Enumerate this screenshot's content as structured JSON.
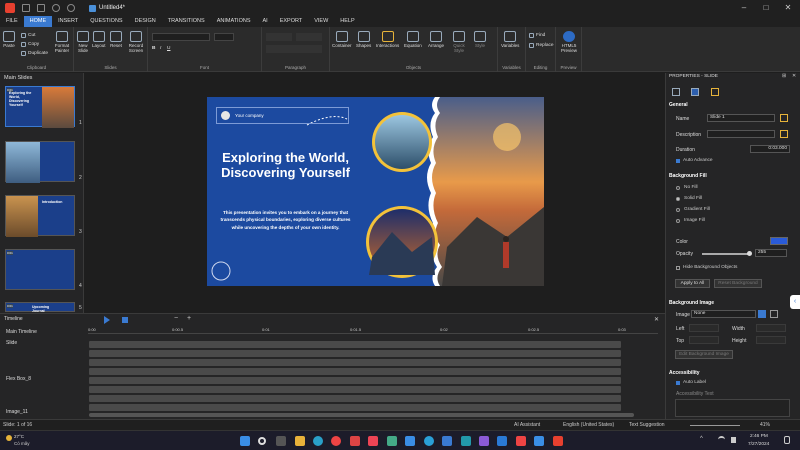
{
  "titlebar": {
    "doc_title": "Untitled4*"
  },
  "menu": [
    "FILE",
    "HOME",
    "INSERT",
    "QUESTIONS",
    "DESIGN",
    "TRANSITIONS",
    "ANIMATIONS",
    "AI",
    "EXPORT",
    "VIEW",
    "HELP"
  ],
  "ribbon": {
    "clipboard": {
      "paste": "Paste",
      "cut": "Cut",
      "copy": "Copy",
      "duplicate": "Duplicate",
      "format_painter": "Format Painter",
      "label": "Clipboard"
    },
    "slides": {
      "new_slide": "New Slide",
      "layout": "Layout",
      "reset": "Reset",
      "record": "Record Screen",
      "label": "Slides"
    },
    "font": {
      "label": "Font"
    },
    "paragraph": {
      "label": "Paragraph"
    },
    "objects": {
      "container": "Container",
      "shapes": "Shapes",
      "interactions": "Interactions",
      "equation": "Equation",
      "arrange": "Arrange",
      "quick_style": "Quick Style",
      "style": "Style",
      "label": "Objects"
    },
    "variables": {
      "btn": "Variables",
      "label": "Variables"
    },
    "editing": {
      "find": "Find",
      "replace": "Replace",
      "label": "Editing"
    },
    "preview": {
      "btn": "HTML5 Preview",
      "label": "Preview"
    }
  },
  "slides_panel": {
    "title": "Main Slides",
    "thumbs": [
      {
        "num": "1",
        "title": "Exploring the World, Discovering Yourself",
        "badge": "0:01"
      },
      {
        "num": "2",
        "title": "",
        "badge": "0:01"
      },
      {
        "num": "3",
        "title": "Introduction",
        "badge": ""
      },
      {
        "num": "4",
        "title": "",
        "badge": "0:01"
      },
      {
        "num": "5",
        "title": "Upcoming Journal",
        "badge": "0:01"
      }
    ]
  },
  "slide": {
    "company": "Your company",
    "title": "Exploring the World, Discovering Yourself",
    "body": "This presentation invites you to embark on a journey that transcends physical boundaries, exploring diverse cultures while uncovering the depths of your own identity."
  },
  "timeline": {
    "title": "Timeline",
    "ticks": [
      "0:00",
      "0:00.5",
      "0:01",
      "0:01.5",
      "0:02",
      "0:02.5",
      "0:03"
    ],
    "rows": [
      "Main Timeline",
      "Slide",
      "Flex Box_8",
      "Image_11"
    ]
  },
  "properties": {
    "title": "PROPERTIES - SLIDE",
    "general": "General",
    "name_label": "Name",
    "name_value": "Slide 1",
    "description_label": "Description",
    "duration_label": "Duration",
    "duration_value": "0:03.000",
    "auto_advance": "Auto Advance",
    "bg_fill": "Background Fill",
    "fill_options": [
      "No Fill",
      "Solid Fill",
      "Gradient Fill",
      "Image Fill"
    ],
    "color_label": "Color",
    "accent": "#2a5bd8",
    "opacity_label": "Opacity",
    "opacity_value": "255",
    "opacity_level": 1.0,
    "hide_bg": "Hide Background Objects",
    "apply_all": "Apply to All",
    "reset_bg": "Reset Background",
    "bg_image": "Background Image",
    "image_label": "Image",
    "image_value": "None",
    "left": "Left",
    "width": "Width",
    "top": "Top",
    "height": "Height",
    "edit_bg_image": "Edit Background Image",
    "accessibility": "Accessibility",
    "auto_label": "Auto Label",
    "accessibility_text": "Accessibility Text"
  },
  "status": {
    "slide_info": "Slide: 1 of 16",
    "ai": "AI Assistant",
    "lang": "English (United States)",
    "suggest": "Text Suggestion",
    "zoom": "41%"
  },
  "taskbar": {
    "weather_temp": "27°C",
    "weather_desc": "Có mây",
    "time": "2:46 PM",
    "date": "7/27/2024"
  }
}
